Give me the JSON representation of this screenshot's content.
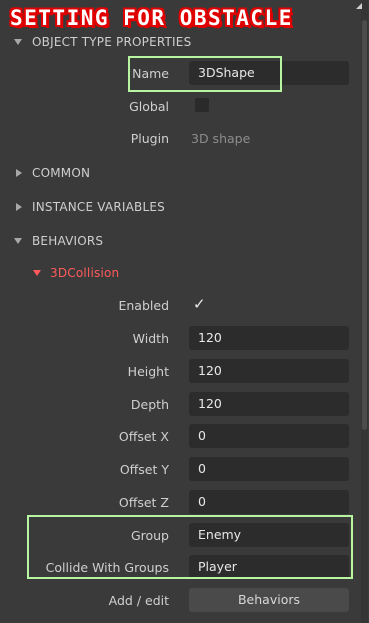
{
  "banner": {
    "title": "SETTING FOR OBSTACLE"
  },
  "sections": {
    "object_type": "OBJECT TYPE PROPERTIES",
    "common": "COMMON",
    "instance_vars": "INSTANCE VARIABLES",
    "behaviors": "BEHAVIORS"
  },
  "object_type": {
    "name_label": "Name",
    "name_value": "3DShape",
    "global_label": "Global",
    "plugin_label": "Plugin",
    "plugin_value": "3D shape"
  },
  "behavior": {
    "title": "3DCollision",
    "enabled_label": "Enabled",
    "width_label": "Width",
    "width_value": "120",
    "height_label": "Height",
    "height_value": "120",
    "depth_label": "Depth",
    "depth_value": "120",
    "offset_x_label": "Offset X",
    "offset_x_value": "0",
    "offset_y_label": "Offset Y",
    "offset_y_value": "0",
    "offset_z_label": "Offset Z",
    "offset_z_value": "0",
    "group_label": "Group",
    "group_value": "Enemy",
    "collide_label": "Collide With Groups",
    "collide_value": "Player",
    "add_edit_label": "Add / edit",
    "behaviors_button": "Behaviors"
  },
  "colors": {
    "accent_red": "#ff5a5a",
    "highlight_green": "#b8f5a0",
    "banner_red": "#e00000"
  }
}
